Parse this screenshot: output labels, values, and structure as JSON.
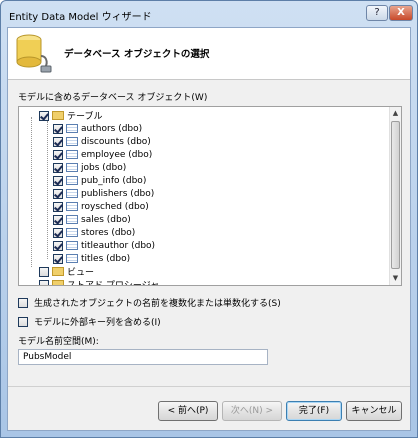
{
  "window": {
    "title": "Entity Data Model ウィザード",
    "help_label": "?",
    "close_label": "X"
  },
  "header": {
    "icon": "database-icon",
    "title": "データベース オブジェクトの選択"
  },
  "objects_label": "モデルに含めるデータベース オブジェクト(W)",
  "tree": {
    "tables_node": {
      "label": "テーブル",
      "state": "checked"
    },
    "tables": [
      {
        "label": "authors (dbo)",
        "checked": true
      },
      {
        "label": "discounts (dbo)",
        "checked": true
      },
      {
        "label": "employee (dbo)",
        "checked": true
      },
      {
        "label": "jobs (dbo)",
        "checked": true
      },
      {
        "label": "pub_info (dbo)",
        "checked": true
      },
      {
        "label": "publishers (dbo)",
        "checked": true
      },
      {
        "label": "roysched (dbo)",
        "checked": true
      },
      {
        "label": "sales (dbo)",
        "checked": true
      },
      {
        "label": "stores (dbo)",
        "checked": true
      },
      {
        "label": "titleauthor (dbo)",
        "checked": true
      },
      {
        "label": "titles (dbo)",
        "checked": true
      }
    ],
    "views_node": {
      "label": "ビュー",
      "state": "unchecked"
    },
    "procedures_node": {
      "label": "ストアド プロシージャ",
      "state": "unchecked"
    }
  },
  "options": {
    "pluralize_label": "生成されたオブジェクトの名前を複数化または単数化する(S)",
    "pluralize_checked": false,
    "foreign_keys_label": "モデルに外部キー列を含める(I)",
    "foreign_keys_checked": false
  },
  "namespace": {
    "label": "モデル名前空間(M):",
    "value": "PubsModel"
  },
  "buttons": {
    "back": "< 前へ(P)",
    "next": "次へ(N) >",
    "finish": "完了(F)",
    "cancel": "キャンセル"
  }
}
